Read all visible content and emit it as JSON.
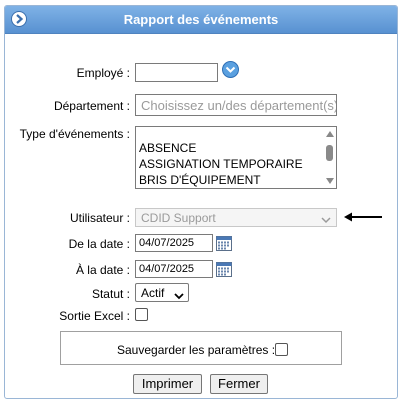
{
  "dialog": {
    "title": "Rapport des événements"
  },
  "form": {
    "employe_label": "Employé :",
    "employe_value": "",
    "departement_label": "Département :",
    "departement_placeholder": "Choisissez un/des département(s)",
    "type_label": "Type d'événements :",
    "type_options": [
      "ABSENCE",
      "ASSIGNATION TEMPORAIRE",
      "BRIS D'ÉQUIPEMENT"
    ],
    "utilisateur_label": "Utilisateur :",
    "utilisateur_value": "CDID Support",
    "de_label": "De la date :",
    "de_value": "04/07/2025",
    "a_label": "À la date :",
    "a_value": "04/07/2025",
    "statut_label": "Statut :",
    "statut_value": "Actif",
    "excel_label": "Sortie Excel :",
    "save_label": "Sauvegarder les paramètres :"
  },
  "buttons": {
    "print": "Imprimer",
    "close": "Fermer"
  },
  "icons": {
    "title": "arrow-right-circle-icon",
    "dropdown": "chevron-down-circle-icon",
    "calendar": "calendar-icon",
    "annotation": "arrow-left-annotation"
  },
  "colors": {
    "titlebar": "#5b95d4",
    "accent": "#4a90d9"
  }
}
